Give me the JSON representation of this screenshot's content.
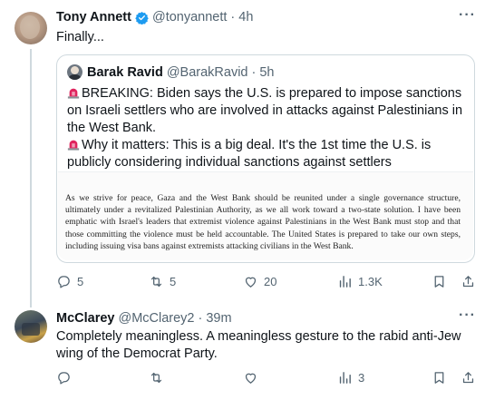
{
  "tweet1": {
    "display_name": "Tony Annett",
    "handle": "@tonyannett",
    "time": "· 4h",
    "text": "Finally...",
    "quoted": {
      "display_name": "Barak Ravid",
      "handle": "@BarakRavid",
      "time": "· 5h",
      "line1": "BREAKING: Biden says the U.S. is prepared to impose sanctions on Israeli settlers who are involved in attacks against Palestinians in the West Bank.",
      "line2": "Why it matters: This is a big deal. It's the 1st time the U.S. is publicly considering individual sanctions against settlers",
      "document_text": "As we strive for peace, Gaza and the West Bank should be reunited under a single governance structure, ultimately under a revitalized Palestinian Authority, as we all work toward a two-state solution. I have been emphatic with Israel's leaders that extremist violence against Palestinians in the West Bank must stop and that those committing the violence must be held accountable. The United States is prepared to take our own steps, including issuing visa bans against extremists attacking civilians in the West Bank."
    },
    "actions": {
      "replies": "5",
      "reposts": "5",
      "likes": "20",
      "views": "1.3K"
    }
  },
  "tweet2": {
    "display_name": "McClarey",
    "handle": "@McClarey2",
    "time": "· 39m",
    "text": "Completely meaningless.  A meaningless gesture to the rabid anti-Jew wing of the Democrat Party.",
    "actions": {
      "views": "3"
    }
  },
  "icons": [
    "more-icon",
    "verified-icon",
    "siren-icon",
    "reply-icon",
    "repost-icon",
    "like-icon",
    "views-icon",
    "bookmark-icon",
    "share-icon"
  ],
  "colors": {
    "secondary_text": "#536471",
    "verified_blue": "#1d9bf0",
    "siren_red": "#e0245e"
  }
}
